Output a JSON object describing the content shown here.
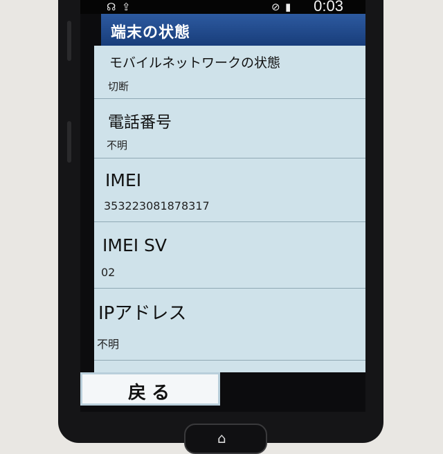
{
  "status_bar": {
    "time": "0:03",
    "left_icons": [
      "headset-icon",
      "upload-icon"
    ],
    "right_icons": [
      "no-sim-icon",
      "battery-icon"
    ]
  },
  "title_bar": {
    "title": "端末の状態",
    "color": "#1f4a8c"
  },
  "rows": [
    {
      "title": "モバイルネットワークの状態",
      "value": "切断"
    },
    {
      "title": "電話番号",
      "value": "不明"
    },
    {
      "title": "IMEI",
      "value": "353223081878317"
    },
    {
      "title": "IMEI SV",
      "value": "02"
    },
    {
      "title": "IPアドレス",
      "value": "不明"
    }
  ],
  "back_button": {
    "label": "戻る"
  },
  "colors": {
    "list_bg": "#cfe2ea",
    "divider": "#8fa8b4",
    "back_bg": "#f4f7f9"
  }
}
